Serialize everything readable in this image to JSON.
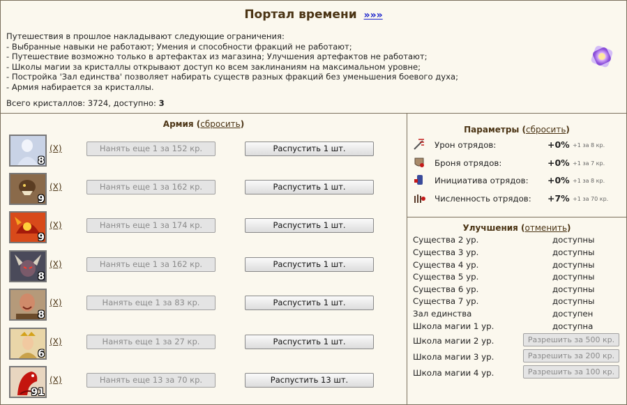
{
  "header": {
    "title": "Портал времени",
    "title_link": "»»»",
    "restrictions_intro": "Путешествия в прошлое накладывают следующие ограничения:",
    "restrictions": [
      "- Выбранные навыки не работают; Умения и способности фракций не работают;",
      "- Путешествие возможно только в артефактах из магазина; Улучшения артефактов не работают;",
      "- Школы магии за кристаллы открывают доступ ко всем заклинаниям на максимальном уровне;",
      "- Постройка 'Зал единства' позволяет набирать существ разных фракций без уменьшения боевого духа;",
      "- Армия набирается за кристаллы."
    ],
    "crystals_label": "Всего кристаллов: 3724, доступно:",
    "crystals_available": "3",
    "portal_icon": "portal-crystal-icon"
  },
  "army": {
    "title": "Армия",
    "reset_link": "сбросить",
    "units": [
      {
        "count": "8",
        "icon": "pale-figure-icon",
        "remove": "(X)",
        "hire": "Нанять еще 1 за 152 кр.",
        "dismiss": "Распустить 1 шт."
      },
      {
        "count": "9",
        "icon": "brown-beast-icon",
        "remove": "(X)",
        "hire": "Нанять еще 1 за 162 кр.",
        "dismiss": "Распустить 1 шт."
      },
      {
        "count": "9",
        "icon": "red-dragon-icon",
        "remove": "(X)",
        "hire": "Нанять еще 1 за 174 кр.",
        "dismiss": "Распустить 1 шт."
      },
      {
        "count": "8",
        "icon": "horned-demon-icon",
        "remove": "(X)",
        "hire": "Нанять еще 1 за 162 кр.",
        "dismiss": "Распустить 1 шт."
      },
      {
        "count": "8",
        "icon": "bald-warrior-icon",
        "remove": "(X)",
        "hire": "Нанять еще 1 за 83 кр.",
        "dismiss": "Распустить 1 шт."
      },
      {
        "count": "6",
        "icon": "crowned-woman-icon",
        "remove": "(X)",
        "hire": "Нанять еще 1 за 27 кр.",
        "dismiss": "Распустить 1 шт."
      },
      {
        "count": "91",
        "icon": "red-horse-icon",
        "remove": "(X)",
        "hire": "Нанять еще 13 за 70 кр.",
        "dismiss": "Распустить 13 шт."
      }
    ]
  },
  "params": {
    "title": "Параметры",
    "reset_link": "сбросить",
    "rows": [
      {
        "icon": "sword-damage-icon",
        "label": "Урон отрядов:",
        "value": "+0%",
        "note": "+1 за 8 кр."
      },
      {
        "icon": "armor-icon",
        "label": "Броня отрядов:",
        "value": "+0%",
        "note": "+1 за 7 кр."
      },
      {
        "icon": "initiative-icon",
        "label": "Инициатива отрядов:",
        "value": "+0%",
        "note": "+1 за 8 кр."
      },
      {
        "icon": "troops-count-icon",
        "label": "Численность отрядов:",
        "value": "+7%",
        "note": "+1 за 70 кр."
      }
    ]
  },
  "upgrades": {
    "title": "Улучшения",
    "cancel_link": "отменить",
    "rows": [
      {
        "name": "Существа 2 ур.",
        "state": "доступны"
      },
      {
        "name": "Существа 3 ур.",
        "state": "доступны"
      },
      {
        "name": "Существа 4 ур.",
        "state": "доступны"
      },
      {
        "name": "Существа 5 ур.",
        "state": "доступны"
      },
      {
        "name": "Существа 6 ур.",
        "state": "доступны"
      },
      {
        "name": "Существа 7 ур.",
        "state": "доступны"
      },
      {
        "name": "Зал единства",
        "state": "доступен"
      },
      {
        "name": "Школа магии 1 ур.",
        "state": "доступна"
      }
    ],
    "magic_buttons": [
      {
        "name": "Школа магии 2 ур.",
        "button": "Разрешить за 500 кр."
      },
      {
        "name": "Школа магии 3 ур.",
        "button": "Разрешить за 200 кр."
      },
      {
        "name": "Школа магии 4 ур.",
        "button": "Разрешить за 100 кр."
      }
    ]
  },
  "colors": {
    "background": "#fbf8ee",
    "border": "#7a6f5c",
    "heading": "#4b3414",
    "link": "#1a22cc"
  }
}
